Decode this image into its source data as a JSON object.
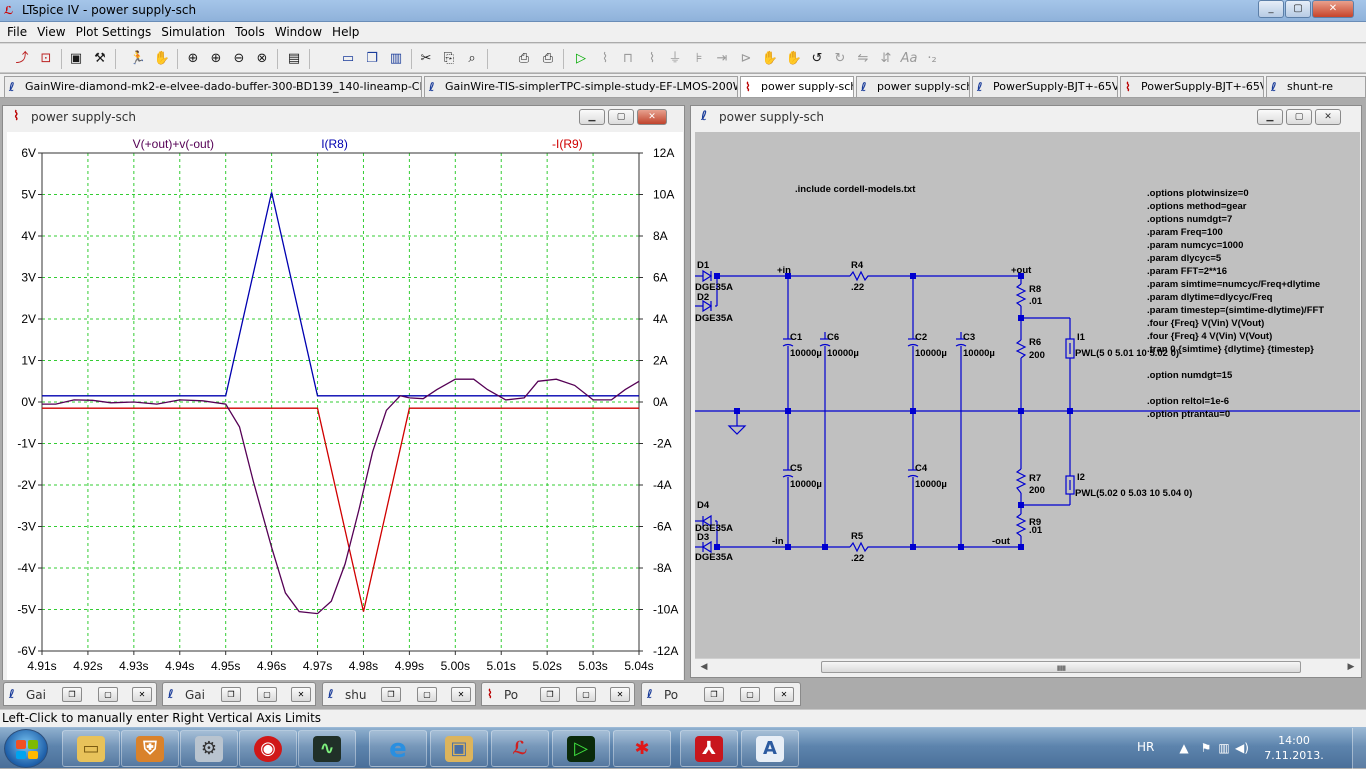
{
  "window": {
    "title": "LTspice IV - power supply-sch",
    "min": "_",
    "max": "▢",
    "close": "✕"
  },
  "menu": [
    "File",
    "View",
    "Plot Settings",
    "Simulation",
    "Tools",
    "Window",
    "Help"
  ],
  "toolbar_icons": [
    "open-icon",
    "new-schematic-icon",
    "save-icon",
    "control-panel-icon",
    "run-icon",
    "halt-icon",
    "zoom-area-icon",
    "zoom-in-icon",
    "zoom-out-icon",
    "zoom-fit-icon",
    "autorange-icon",
    "tile-horizontal-icon",
    "cascade-icon",
    "tile-vertical-icon",
    "cut-icon",
    "copy-icon",
    "find-icon",
    "print-setup-icon",
    "print-icon",
    "component-icon",
    "resistor-icon",
    "capacitor-icon",
    "inductor-icon",
    "diode-icon",
    "ground-icon",
    "move-icon",
    "drag-icon",
    "undo-icon",
    "redo-icon",
    "rotate-icon",
    "mirror-icon",
    "text-icon",
    "spice-directive-icon"
  ],
  "tabs": [
    {
      "label": "GainWire-diamond-mk2-e-elvee-dado-buffer-300-BD139_140-lineamp-CFA+-15V-c",
      "icon": "schematic-icon"
    },
    {
      "label": "GainWire-TIS-simplerTPC-simple-study-EF-LMOS-200W-final",
      "icon": "schematic-icon"
    },
    {
      "label": "power supply-sch",
      "icon": "waveform-icon"
    },
    {
      "label": "power supply-sch",
      "icon": "schematic-icon"
    },
    {
      "label": "PowerSupply-BJT+-65V",
      "icon": "schematic-icon"
    },
    {
      "label": "PowerSupply-BJT+-65V",
      "icon": "waveform-icon"
    },
    {
      "label": "shunt-re",
      "icon": "schematic-icon"
    }
  ],
  "plot_window": {
    "title": "power supply-sch"
  },
  "schematic_window": {
    "title": "power supply-sch"
  },
  "chart_data": {
    "type": "line",
    "traces": [
      "V(+out)+v(-out)",
      "I(R8)",
      "-I(R9)"
    ],
    "colors": {
      "V(+out)+v(-out)": "#550055",
      "I(R8)": "#0000b0",
      "-I(R9)": "#d00000"
    },
    "xlim": [
      4.91,
      5.04
    ],
    "x_ticks": [
      "4.91s",
      "4.92s",
      "4.93s",
      "4.94s",
      "4.95s",
      "4.96s",
      "4.97s",
      "4.98s",
      "4.99s",
      "5.00s",
      "5.01s",
      "5.02s",
      "5.03s",
      "5.04s"
    ],
    "y_left_ticks": [
      "6V",
      "5V",
      "4V",
      "3V",
      "2V",
      "1V",
      "0V",
      "-1V",
      "-2V",
      "-3V",
      "-4V",
      "-5V",
      "-6V"
    ],
    "y_right_ticks": [
      "12A",
      "10A",
      "8A",
      "6A",
      "4A",
      "2A",
      "0A",
      "-2A",
      "-4A",
      "-6A",
      "-8A",
      "-10A",
      "-12A"
    ],
    "ylim_left": [
      -6,
      6
    ],
    "ylim_right": [
      -12,
      12
    ],
    "grid": true,
    "series": [
      {
        "name": "I(R8)",
        "axis": "right",
        "x": [
          4.91,
          4.95,
          4.96,
          4.97,
          5.04
        ],
        "y": [
          0.3,
          0.3,
          10.1,
          0.3,
          0.3
        ]
      },
      {
        "name": "-I(R9)",
        "axis": "right",
        "x": [
          4.91,
          4.97,
          4.98,
          4.99,
          5.04
        ],
        "y": [
          -0.3,
          -0.3,
          -10.1,
          -0.3,
          -0.3
        ]
      },
      {
        "name": "V(+out)+v(-out)",
        "axis": "left",
        "x": [
          4.91,
          4.913,
          4.917,
          4.921,
          4.925,
          4.93,
          4.935,
          4.94,
          4.945,
          4.95,
          4.953,
          4.956,
          4.96,
          4.963,
          4.966,
          4.97,
          4.973,
          4.976,
          4.979,
          4.982,
          4.985,
          4.988,
          4.99,
          4.993,
          4.996,
          5.0,
          5.004,
          5.007,
          5.011,
          5.015,
          5.018,
          5.022,
          5.026,
          5.03,
          5.034,
          5.037,
          5.04
        ],
        "y": [
          -0.05,
          -0.05,
          0.05,
          0.04,
          -0.02,
          0.0,
          -0.05,
          0.05,
          0.03,
          -0.05,
          -0.6,
          -1.9,
          -3.5,
          -4.6,
          -5.05,
          -5.1,
          -4.8,
          -3.9,
          -2.6,
          -1.2,
          -0.2,
          0.15,
          0.1,
          0.08,
          0.3,
          0.55,
          0.55,
          0.3,
          0.05,
          0.1,
          0.5,
          0.55,
          0.4,
          0.05,
          0.05,
          0.3,
          0.5
        ]
      }
    ]
  },
  "schematic": {
    "include": ".include cordell-models.txt",
    "directives": [
      ".options plotwinsize=0",
      ".options method=gear",
      ".options numdgt=7",
      ".param Freq=100",
      ".param numcyc=1000",
      ".param dlycyc=5",
      ".param FFT=2**16",
      ".param simtime=numcyc/Freq+dlytime",
      ".param dlytime=dlycyc/Freq",
      ".param timestep=(simtime-dlytime)/FFT",
      ".four {Freq} V(Vin) V(Vout)",
      ".four {Freq} 4 V(Vin) V(Vout)",
      ".tran 0 {simtime} {dlytime} {timestep}",
      "",
      ".option numdgt=15",
      "",
      ".option reltol=1e-6",
      ".option ptrantau=0"
    ],
    "nets": {
      "in_pos": "+in",
      "in_neg": "-in",
      "out_pos": "+out",
      "out_neg": "-out"
    },
    "diodes": [
      {
        "name": "D1",
        "model": "DGE35A"
      },
      {
        "name": "D2",
        "model": "DGE35A"
      },
      {
        "name": "D4",
        "model": "DGE35A"
      },
      {
        "name": "D3",
        "model": "DGE35A"
      }
    ],
    "resistors": [
      {
        "name": "R4",
        "value": ".22"
      },
      {
        "name": "R5",
        "value": ".22"
      },
      {
        "name": "R8",
        "value": ".01"
      },
      {
        "name": "R9",
        "value": ".01"
      },
      {
        "name": "R6",
        "value": "200"
      },
      {
        "name": "R7",
        "value": "200"
      }
    ],
    "capacitors": [
      {
        "name": "C1",
        "value": "10000µ"
      },
      {
        "name": "C6",
        "value": "10000µ"
      },
      {
        "name": "C2",
        "value": "10000µ"
      },
      {
        "name": "C3",
        "value": "10000µ"
      },
      {
        "name": "C5",
        "value": "10000µ"
      },
      {
        "name": "C4",
        "value": "10000µ"
      }
    ],
    "sources": [
      {
        "name": "I1",
        "value": "PWL(5 0 5.01 10 5.02 0)"
      },
      {
        "name": "I2",
        "value": "PWL(5.02 0 5.03 10 5.04 0)"
      }
    ]
  },
  "minimized": [
    {
      "label": "Gai",
      "icon": "schematic-icon"
    },
    {
      "label": "Gai",
      "icon": "schematic-icon"
    },
    {
      "label": "shu",
      "icon": "schematic-icon"
    },
    {
      "label": "Po",
      "icon": "waveform-icon"
    },
    {
      "label": "Po",
      "icon": "schematic-icon"
    }
  ],
  "status": "Left-Click to manually enter Right Vertical Axis Limits",
  "taskbar": {
    "apps": [
      "explorer-icon",
      "firewall-icon",
      "media-icon",
      "security-icon",
      "scope-icon",
      "ie-icon",
      "pictures-icon",
      "ltspice-icon",
      "simulator-icon",
      "bug-icon",
      "pdf-icon",
      "document-icon"
    ],
    "lang": "HR",
    "time": "14:00",
    "date": "7.11.2013."
  }
}
